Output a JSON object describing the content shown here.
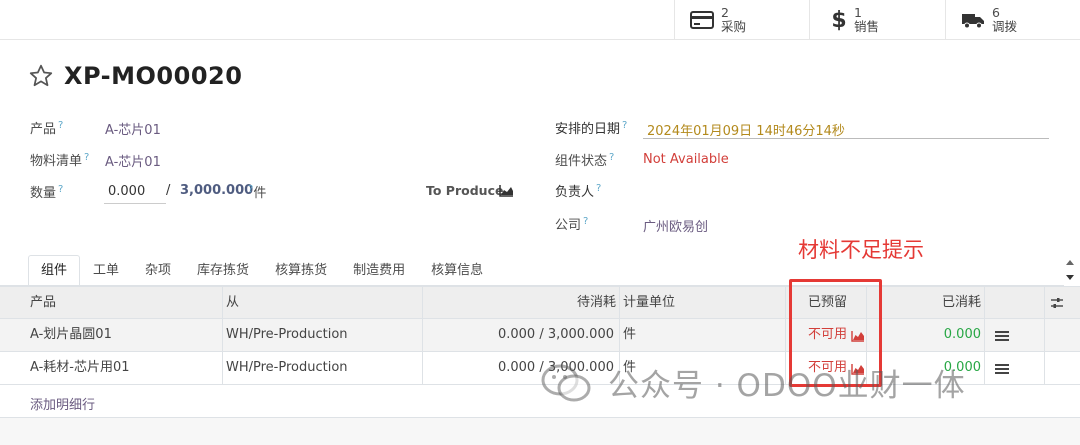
{
  "stats": [
    {
      "count": "2",
      "label": "采购",
      "icon": "credit-card-icon"
    },
    {
      "count": "1",
      "label": "销售",
      "icon": "dollar-icon"
    },
    {
      "count": "6",
      "label": "调拨",
      "icon": "truck-icon"
    }
  ],
  "record": {
    "title": "XP-MO00020"
  },
  "fields": {
    "product_label": "产品",
    "product_value": "A-芯片01",
    "bom_label": "物料清单",
    "bom_value": "A-芯片01",
    "qty_label": "数量",
    "qty_value": "0.000",
    "qty_sep": "/",
    "qty_total": "3,000.000",
    "qty_unit": "件",
    "to_produce": "To Produce",
    "scheduled_label": "安排的日期",
    "scheduled_value": "2024年01月09日 14时46分14秒",
    "component_status_label": "组件状态",
    "component_status_value": "Not Available",
    "responsible_label": "负责人",
    "company_label": "公司",
    "company_value": "广州欧易创",
    "help_mark": "?"
  },
  "annotation": {
    "text": "材料不足提示",
    "color": "#e53935"
  },
  "tabs": [
    "组件",
    "工单",
    "杂项",
    "库存拣货",
    "核算拣货",
    "制造费用",
    "核算信息"
  ],
  "table": {
    "headers": {
      "product": "产品",
      "from": "从",
      "to_consume": "待消耗",
      "uom": "计量单位",
      "reserved": "已预留",
      "consumed": "已消耗"
    },
    "rows": [
      {
        "product": "A-划片晶圆01",
        "from": "WH/Pre-Production",
        "to_consume": "0.000 /  3,000.000",
        "uom": "件",
        "reserved": "不可用",
        "consumed": "0.000"
      },
      {
        "product": "A-耗材-芯片用01",
        "from": "WH/Pre-Production",
        "to_consume": "0.000 /  3,000.000",
        "uom": "件",
        "reserved": "不可用",
        "consumed": "0.000"
      }
    ],
    "add_line": "添加明细行"
  },
  "watermark": {
    "text": "公众号 · ODOO业财一体"
  },
  "colors": {
    "link": "#6a5b80",
    "help": "#5fa8c9",
    "danger": "#d23f3a",
    "success": "#28a745"
  }
}
